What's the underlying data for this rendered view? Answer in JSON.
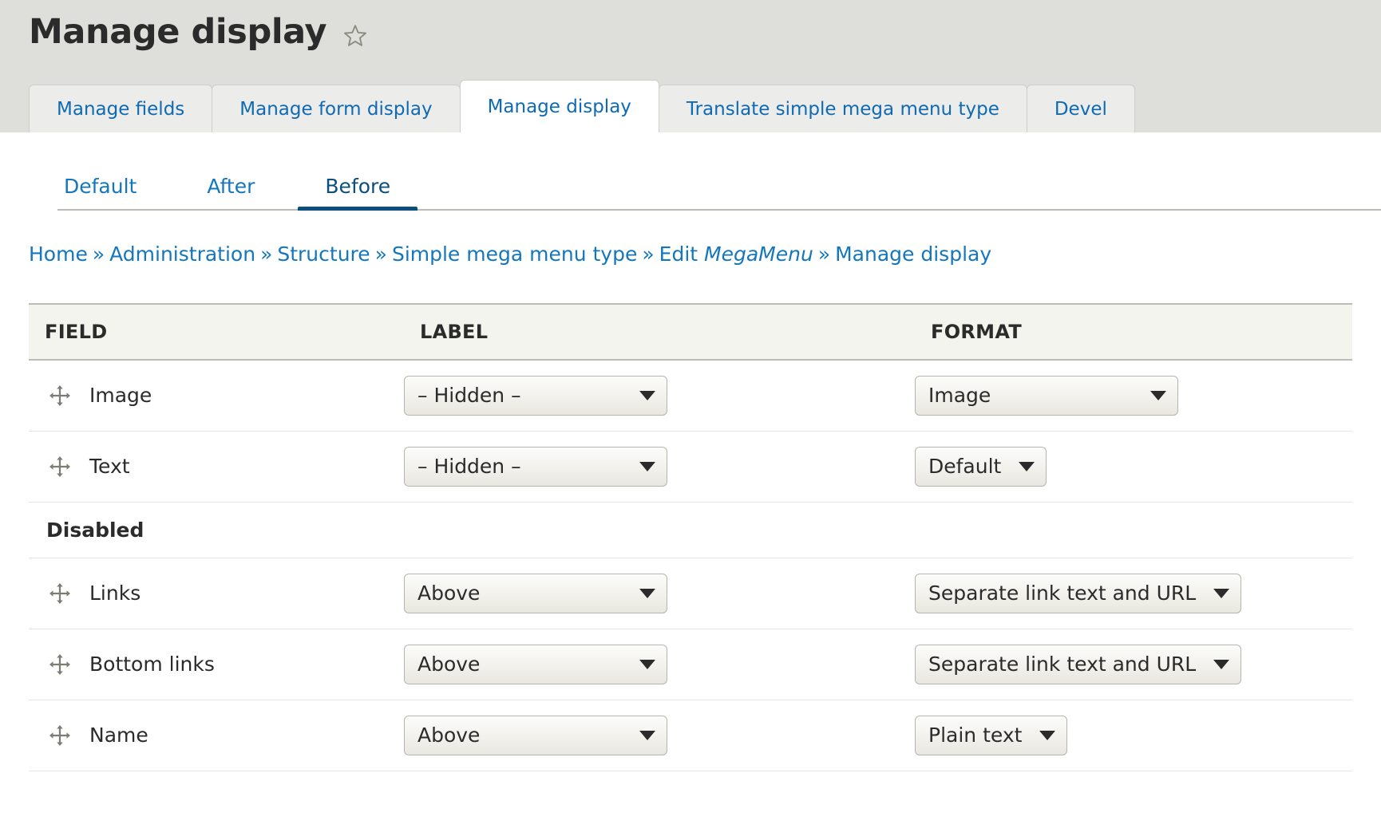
{
  "header": {
    "title": "Manage display",
    "star_icon": "star-outline-icon"
  },
  "primary_tabs": [
    {
      "label": "Manage fields",
      "active": false
    },
    {
      "label": "Manage form display",
      "active": false
    },
    {
      "label": "Manage display",
      "active": true
    },
    {
      "label": "Translate simple mega menu type",
      "active": false
    },
    {
      "label": "Devel",
      "active": false
    }
  ],
  "secondary_tabs": [
    {
      "label": "Default",
      "active": false
    },
    {
      "label": "After",
      "active": false
    },
    {
      "label": "Before",
      "active": true
    }
  ],
  "breadcrumb": {
    "separator": "»",
    "items": [
      {
        "text": "Home",
        "italic": false
      },
      {
        "text": "Administration",
        "italic": false
      },
      {
        "text": "Structure",
        "italic": false
      },
      {
        "text": "Simple mega menu type",
        "italic": false
      },
      {
        "text": "Edit ",
        "italic_suffix": "MegaMenu"
      },
      {
        "text": "Manage display",
        "italic": false
      }
    ]
  },
  "table": {
    "columns": {
      "field": "FIELD",
      "label": "LABEL",
      "format": "FORMAT"
    },
    "rows": [
      {
        "type": "field",
        "field": "Image",
        "drag_icon": "move-handle-icon",
        "label_select": "– Hidden –",
        "label_select_width": "fixed",
        "format_select": "Image",
        "format_select_width": "fixed"
      },
      {
        "type": "field",
        "field": "Text",
        "drag_icon": "move-handle-icon",
        "label_select": "– Hidden –",
        "label_select_width": "fixed",
        "format_select": "Default",
        "format_select_width": "auto"
      },
      {
        "type": "section",
        "section_label": "Disabled"
      },
      {
        "type": "field",
        "field": "Links",
        "drag_icon": "move-handle-icon",
        "label_select": "Above",
        "label_select_width": "fixed",
        "format_select": "Separate link text and URL",
        "format_select_width": "auto"
      },
      {
        "type": "field",
        "field": "Bottom links",
        "drag_icon": "move-handle-icon",
        "label_select": "Above",
        "label_select_width": "fixed",
        "format_select": "Separate link text and URL",
        "format_select_width": "auto"
      },
      {
        "type": "field",
        "field": "Name",
        "drag_icon": "move-handle-icon",
        "label_select": "Above",
        "label_select_width": "fixed",
        "format_select": "Plain text",
        "format_select_width": "auto"
      }
    ]
  },
  "colors": {
    "header_band": "#dededa",
    "link_blue": "#1477bd",
    "active_tab_blue": "#0b4f7e",
    "table_head_bg": "#f4f4ef",
    "text": "#2b2b2b"
  }
}
